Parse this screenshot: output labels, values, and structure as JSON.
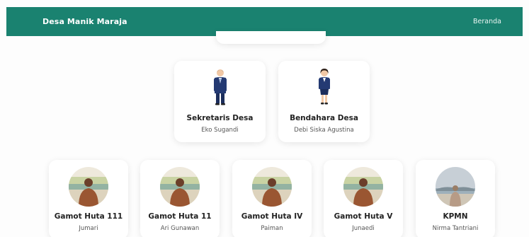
{
  "header": {
    "brand": "Desa Manik Maraja",
    "nav_home": "Beranda"
  },
  "officials": [
    {
      "title": "Sekretaris Desa",
      "name": "Eko Sugandi",
      "icon": "male-official-icon"
    },
    {
      "title": "Bendahara Desa",
      "name": "Debi Siska Agustina",
      "icon": "female-official-icon"
    }
  ],
  "leaders": [
    {
      "title": "Gamot Huta 111",
      "name": "Jumari",
      "icon": "person-photo"
    },
    {
      "title": "Gamot Huta 11",
      "name": "Ari Gunawan",
      "icon": "person-photo"
    },
    {
      "title": "Gamot Huta IV",
      "name": "Paiman",
      "icon": "person-photo"
    },
    {
      "title": "Gamot Huta V",
      "name": "Junaedi",
      "icon": "person-photo"
    },
    {
      "title": "KPMN",
      "name": "Nirma Tantriani",
      "icon": "landscape-photo"
    }
  ],
  "colors": {
    "header": "#1a8270",
    "suit": "#243a73",
    "skin": "#f1c8a5",
    "shirt": "#9a5632"
  }
}
